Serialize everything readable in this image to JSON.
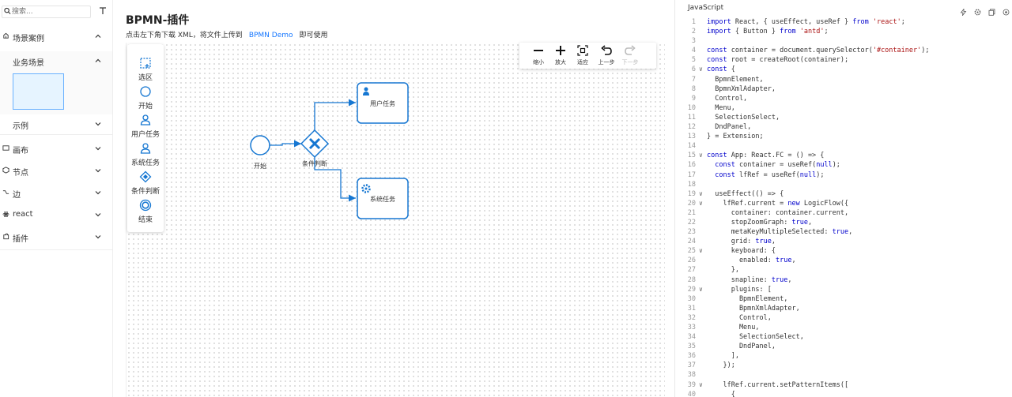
{
  "sidebar": {
    "search_placeholder": "搜索...",
    "items": [
      {
        "label": "场景案例",
        "icon": "case-icon",
        "expanded": true
      },
      {
        "label": "业务场景",
        "expanded": true,
        "child": true
      },
      {
        "label": "示例",
        "child": true
      },
      {
        "label": "画布",
        "icon": "canvas-icon"
      },
      {
        "label": "节点",
        "icon": "node-icon"
      },
      {
        "label": "边",
        "icon": "edge-icon"
      },
      {
        "label": "react",
        "icon": "react-icon"
      },
      {
        "label": "插件",
        "icon": "plugin-icon"
      }
    ]
  },
  "main": {
    "title": "BPMN-插件",
    "desc_before": "点击左下角下载 XML，将文件上传到",
    "desc_link": "BPMN Demo",
    "desc_after": "即可使用"
  },
  "dnd_panel": {
    "items": [
      {
        "label": "选区",
        "icon": "selection-icon"
      },
      {
        "label": "开始",
        "icon": "start-event-icon"
      },
      {
        "label": "用户任务",
        "icon": "user-task-icon"
      },
      {
        "label": "系统任务",
        "icon": "service-task-icon"
      },
      {
        "label": "条件判断",
        "icon": "gateway-icon"
      },
      {
        "label": "结束",
        "icon": "end-event-icon"
      }
    ]
  },
  "control": {
    "items": [
      {
        "label": "缩小",
        "icon": "zoom-out-icon",
        "disabled": false
      },
      {
        "label": "放大",
        "icon": "zoom-in-icon",
        "disabled": false
      },
      {
        "label": "适应",
        "icon": "fit-icon",
        "disabled": false
      },
      {
        "label": "上一步",
        "icon": "undo-icon",
        "disabled": false
      },
      {
        "label": "下一步",
        "icon": "redo-icon",
        "disabled": true
      }
    ]
  },
  "diagram": {
    "start_label": "开始",
    "gateway_label": "条件判断",
    "user_task_label": "用户任务",
    "service_task_label": "系统任务",
    "accent": "#1677d2"
  },
  "code_panel": {
    "language": "JavaScript",
    "lines": [
      {
        "n": "1",
        "fold": "",
        "t": "import React, { useEffect, useRef } from 'react';"
      },
      {
        "n": "2",
        "fold": "",
        "t": "import { Button } from 'antd';"
      },
      {
        "n": "3",
        "fold": "",
        "t": ""
      },
      {
        "n": "4",
        "fold": "",
        "t": "const container = document.querySelector('#container');"
      },
      {
        "n": "5",
        "fold": "",
        "t": "const root = createRoot(container);"
      },
      {
        "n": "6",
        "fold": "v",
        "t": "const {"
      },
      {
        "n": "7",
        "fold": "",
        "t": "  BpmnElement,"
      },
      {
        "n": "8",
        "fold": "",
        "t": "  BpmnXmlAdapter,"
      },
      {
        "n": "9",
        "fold": "",
        "t": "  Control,"
      },
      {
        "n": "10",
        "fold": "",
        "t": "  Menu,"
      },
      {
        "n": "11",
        "fold": "",
        "t": "  SelectionSelect,"
      },
      {
        "n": "12",
        "fold": "",
        "t": "  DndPanel,"
      },
      {
        "n": "13",
        "fold": "",
        "t": "} = Extension;"
      },
      {
        "n": "14",
        "fold": "",
        "t": ""
      },
      {
        "n": "15",
        "fold": "v",
        "t": "const App: React.FC = () => {"
      },
      {
        "n": "16",
        "fold": "",
        "t": "  const container = useRef(null);"
      },
      {
        "n": "17",
        "fold": "",
        "t": "  const lfRef = useRef(null);"
      },
      {
        "n": "18",
        "fold": "",
        "t": ""
      },
      {
        "n": "19",
        "fold": "v",
        "t": "  useEffect(() => {"
      },
      {
        "n": "20",
        "fold": "v",
        "t": "    lfRef.current = new LogicFlow({"
      },
      {
        "n": "21",
        "fold": "",
        "t": "      container: container.current,"
      },
      {
        "n": "22",
        "fold": "",
        "t": "      stopZoomGraph: true,"
      },
      {
        "n": "23",
        "fold": "",
        "t": "      metaKeyMultipleSelected: true,"
      },
      {
        "n": "24",
        "fold": "",
        "t": "      grid: true,"
      },
      {
        "n": "25",
        "fold": "v",
        "t": "      keyboard: {"
      },
      {
        "n": "26",
        "fold": "",
        "t": "        enabled: true,"
      },
      {
        "n": "27",
        "fold": "",
        "t": "      },"
      },
      {
        "n": "28",
        "fold": "",
        "t": "      snapline: true,"
      },
      {
        "n": "29",
        "fold": "v",
        "t": "      plugins: ["
      },
      {
        "n": "30",
        "fold": "",
        "t": "        BpmnElement,"
      },
      {
        "n": "31",
        "fold": "",
        "t": "        BpmnXmlAdapter,"
      },
      {
        "n": "32",
        "fold": "",
        "t": "        Control,"
      },
      {
        "n": "33",
        "fold": "",
        "t": "        Menu,"
      },
      {
        "n": "34",
        "fold": "",
        "t": "        SelectionSelect,"
      },
      {
        "n": "35",
        "fold": "",
        "t": "        DndPanel,"
      },
      {
        "n": "36",
        "fold": "",
        "t": "      ],"
      },
      {
        "n": "37",
        "fold": "",
        "t": "    });"
      },
      {
        "n": "38",
        "fold": "",
        "t": ""
      },
      {
        "n": "39",
        "fold": "v",
        "t": "    lfRef.current.setPatternItems(["
      },
      {
        "n": "40",
        "fold": "",
        "t": "      {"
      }
    ]
  }
}
